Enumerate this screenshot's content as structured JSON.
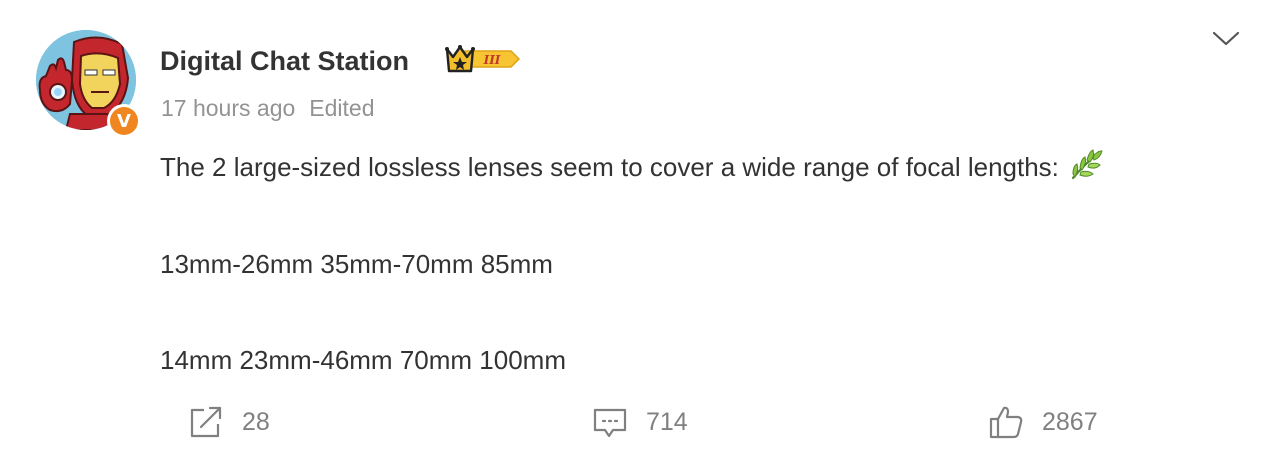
{
  "post": {
    "author": "Digital Chat Station",
    "rank_badge_text": "III",
    "timestamp": "17 hours ago",
    "edited_label": "Edited",
    "verified_mark": "V",
    "content": {
      "line1": "The 2 large-sized lossless lenses seem to cover a wide range of focal lengths:",
      "line2": "13mm-26mm 35mm-70mm 85mm",
      "line3": "14mm 23mm-46mm 70mm 100mm"
    },
    "emoji": "sprout-icon"
  },
  "actions": {
    "share_count": "28",
    "comment_count": "714",
    "like_count": "2867"
  },
  "icons": {
    "avatar": "iron-man-avatar",
    "verified": "verified-v-badge",
    "rank": "crown-rank-badge",
    "more": "chevron-down-icon",
    "share": "share-icon",
    "comment": "comment-icon",
    "like": "thumbs-up-icon"
  },
  "colors": {
    "text": "#333333",
    "meta": "#939393",
    "action": "#808080",
    "verified": "#f0861f",
    "badge_gold": "#f7c531"
  }
}
